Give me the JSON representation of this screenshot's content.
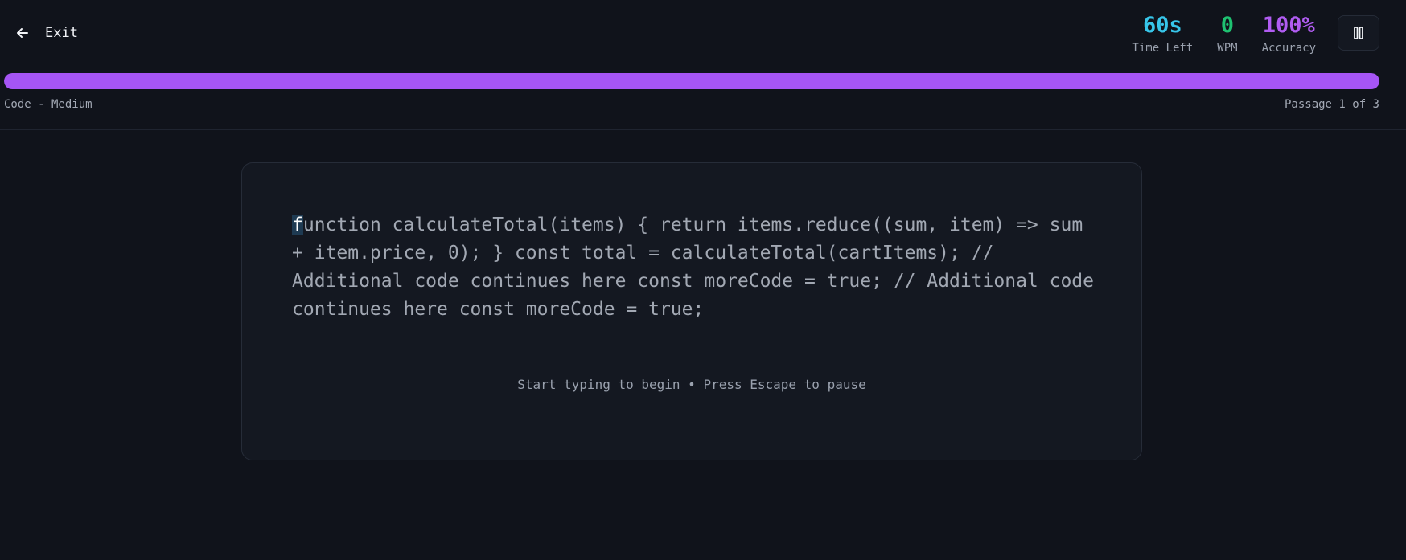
{
  "header": {
    "exit_label": "Exit",
    "stats": {
      "time_value": "60s",
      "time_label": "Time Left",
      "wpm_value": "0",
      "wpm_label": "WPM",
      "accuracy_value": "100%",
      "accuracy_label": "Accuracy"
    },
    "pause_icon": "pause-icon",
    "back_icon": "arrow-left-icon"
  },
  "progress": {
    "fraction": 1.0,
    "mode_label": "Code - Medium",
    "passage_label": "Passage 1 of 3"
  },
  "passage": {
    "current_char": "f",
    "remaining_text": "unction calculateTotal(items) { return items.reduce((sum, item) => sum + item.price, 0); } const total = calculateTotal(cartItems); // Additional code continues here const moreCode = true; // Additional code continues here const moreCode = true;",
    "hint": "Start typing to begin • Press Escape to pause"
  },
  "colors": {
    "background": "#10131b",
    "time": "#37c6ea",
    "wpm": "#1ec271",
    "accuracy": "#b15cf2",
    "progress": "#a655f5"
  }
}
